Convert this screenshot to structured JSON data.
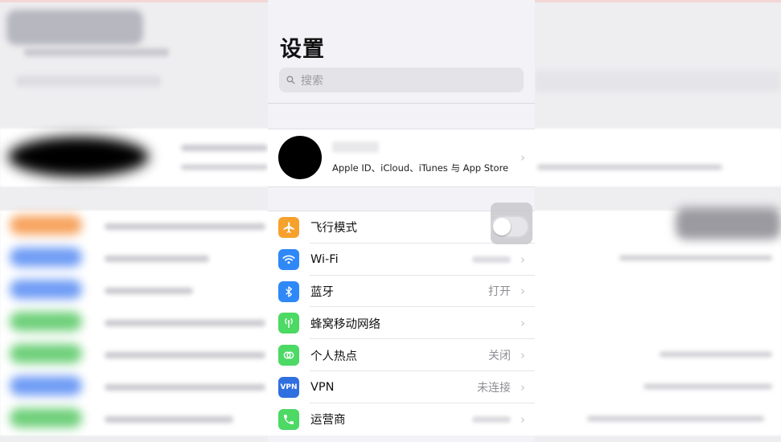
{
  "settings": {
    "title": "设置",
    "search_placeholder": "搜索",
    "profile": {
      "subtitle": "Apple ID、iCloud、iTunes 与 App Store"
    },
    "items": [
      {
        "label": "飞行模式",
        "value": "",
        "color": "#f7a12d",
        "icon": "airplane-icon"
      },
      {
        "label": "Wi-Fi",
        "value": "",
        "color": "#2f88f7",
        "icon": "wifi-icon"
      },
      {
        "label": "蓝牙",
        "value": "打开",
        "color": "#2f88f7",
        "icon": "bluetooth-icon"
      },
      {
        "label": "蜂窝移动网络",
        "value": "",
        "color": "#4cd964",
        "icon": "cellular-icon"
      },
      {
        "label": "个人热点",
        "value": "关闭",
        "color": "#4cd964",
        "icon": "hotspot-icon"
      },
      {
        "label": "VPN",
        "value": "未连接",
        "color": "#2f6fe0",
        "icon": "vpn-icon",
        "icon_text": "VPN"
      },
      {
        "label": "运营商",
        "value": "",
        "color": "#4cd964",
        "icon": "carrier-phone-icon"
      }
    ]
  }
}
